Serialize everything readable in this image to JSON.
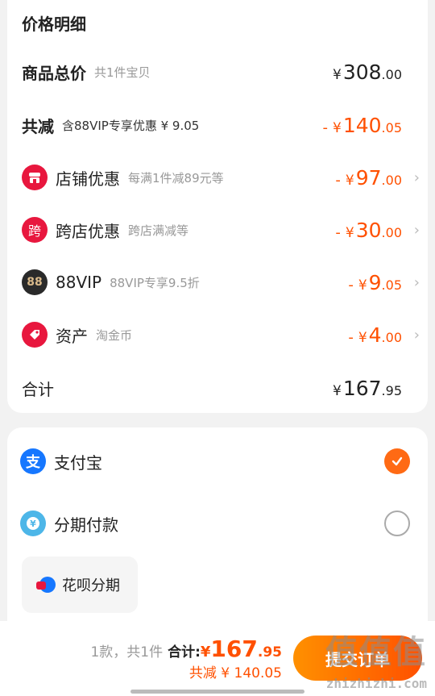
{
  "price_detail": {
    "title": "价格明细",
    "rows": [
      {
        "label": "商品总价",
        "sub": "共1件宝贝",
        "sign": "",
        "yen": "¥",
        "int": "308",
        "dec": ".00"
      },
      {
        "label": "共减",
        "sub": "含88VIP专享优惠 ¥ 9.05",
        "sign": "-",
        "yen": "¥",
        "int": "140",
        "dec": ".05"
      },
      {
        "label": "店铺优惠",
        "sub": "每满1件减89元等",
        "sign": "-",
        "yen": "¥",
        "int": "97",
        "dec": ".00"
      },
      {
        "label": "跨店优惠",
        "sub": "跨店满减等",
        "sign": "-",
        "yen": "¥",
        "int": "30",
        "dec": ".00"
      },
      {
        "label": "88VIP",
        "sub": "88VIP专享9.5折",
        "sign": "-",
        "yen": "¥",
        "int": "9",
        "dec": ".05"
      },
      {
        "label": "资产",
        "sub": "淘金币",
        "sign": "-",
        "yen": "¥",
        "int": "4",
        "dec": ".00"
      },
      {
        "label": "合计",
        "sub": "",
        "sign": "",
        "yen": "¥",
        "int": "167",
        "dec": ".95"
      }
    ],
    "icons": {
      "shop": "店",
      "cross": "跨",
      "vip": "88"
    }
  },
  "payment": {
    "alipay": {
      "label": "支付宝",
      "selected": true
    },
    "installment": {
      "label": "分期付款",
      "selected": false
    },
    "huabei": {
      "label": "花呗分期"
    }
  },
  "footer": {
    "count": "1款，共1件",
    "total_label": "合计:",
    "yen": "¥",
    "int": "167",
    "dec": ".95",
    "saved": "共减 ¥ 140.05",
    "submit": "提交订单"
  },
  "watermark": {
    "text": "值值值",
    "sub": "zhizhizhi.com"
  },
  "colors": {
    "accent": "#ff5000",
    "shop_icon": "#e8173e",
    "cross_icon": "#e8173e",
    "vip_icon": "#2a2a2a",
    "asset_icon": "#e8173e",
    "alipay": "#1677ff"
  }
}
